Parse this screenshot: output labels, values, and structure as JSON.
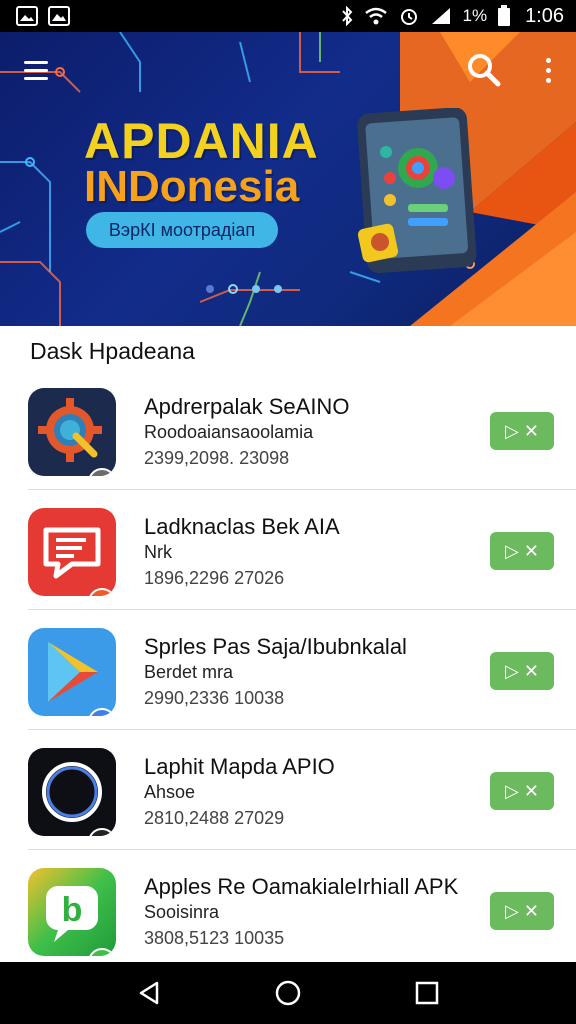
{
  "status_bar": {
    "battery_text": "1%",
    "time": "1:06",
    "icons": [
      "image-icon",
      "gallery-icon",
      "bluetooth-icon",
      "wifi-icon",
      "signal-icon",
      "battery-icon"
    ]
  },
  "banner": {
    "title": "APDANIA",
    "subtitle": "INDonesia",
    "pill_label": "ВэрКІ моотрадіап",
    "carousel_pages": 4,
    "carousel_active": 1,
    "colors": {
      "background": "#122c8a",
      "accent_orange": "#f26a1b",
      "title": "#f2d21f",
      "subtitle": "#f7a21c",
      "pill": "#3fb6e6"
    }
  },
  "section": {
    "title": "Dask Hpadeana"
  },
  "apps": [
    {
      "name": "Apdrerpalak SeAINO",
      "sub": "Roodoaiansaoolamia",
      "meta": "2399,2098. 23098",
      "icon": "gear-globe-icon",
      "badge": "hangouts-badge-icon",
      "download_label": "▷ ✕"
    },
    {
      "name": "Ladknaclas Bek AIA",
      "sub": "Nrk",
      "meta": "1896,2296  27026",
      "icon": "chat-icon",
      "badge": "swap-badge-icon",
      "download_label": "▷ ✕"
    },
    {
      "name": "Sprles Pas Saja/Ibubnkalal",
      "sub": "Berdet mra",
      "meta": "2990,2336  10038",
      "icon": "play-store-icon",
      "badge": "messenger-badge-icon",
      "download_label": "▷ ✕"
    },
    {
      "name": "Laphit Mapda APIO",
      "sub": "Ahsoe",
      "meta": "2810,2488  27029",
      "icon": "compass-icon",
      "badge": "feather-badge-icon",
      "download_label": "▷ ✕"
    },
    {
      "name": "Apples Re OamakialeIrhiall APK",
      "sub": "Sooisinra",
      "meta": "3808,5123  10035",
      "icon": "b-logo-icon",
      "badge": "whatsapp-badge-icon",
      "download_label": "▷ ✕"
    }
  ],
  "nav": {
    "back": "back-icon",
    "home": "home-icon",
    "recents": "recents-icon"
  },
  "colors": {
    "download_button": "#6cba5e",
    "divider": "#dedede"
  }
}
